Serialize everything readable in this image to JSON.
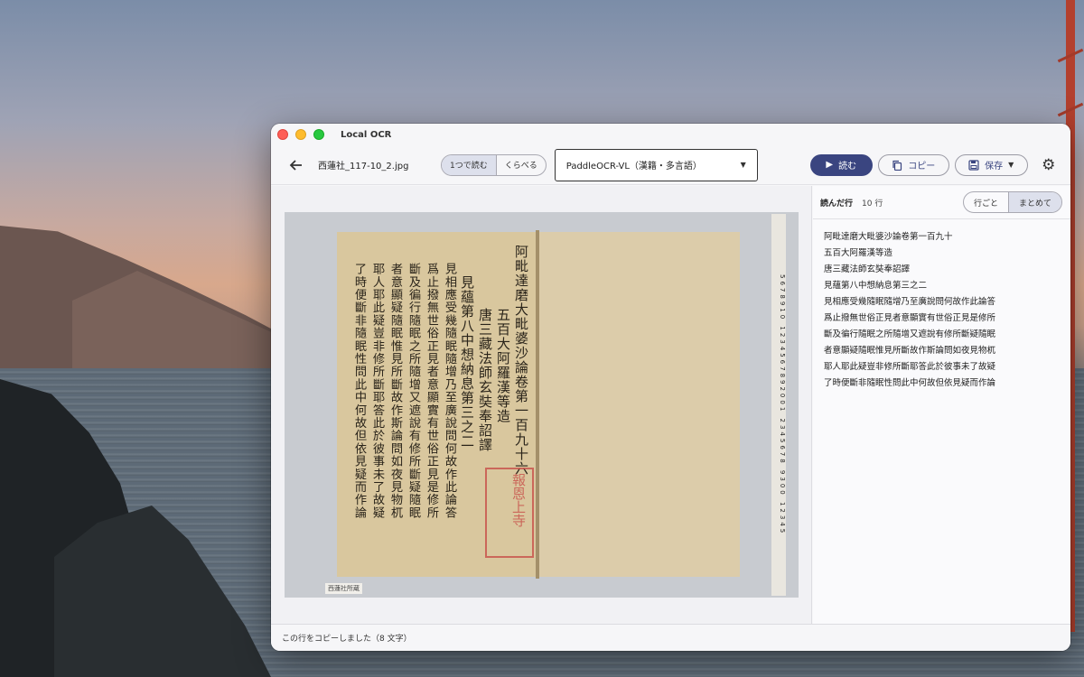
{
  "window": {
    "title": "Local OCR",
    "filename": "西蓮社_117-10_2.jpg"
  },
  "toolbar": {
    "mode_single": "1つで読む",
    "mode_compare": "くらべる",
    "model": "PaddleOCR-VL（漢籍・多言語）",
    "read_label": "読む",
    "copy_label": "コピー",
    "save_label": "保存"
  },
  "image": {
    "columns": [
      "阿毗達磨大毗婆沙論卷第一百九十六",
      "五百大阿羅漢等造",
      "唐三藏法師玄奘奉詔譯",
      "見蘊第八中想納息第三之二",
      "見相應受幾隨眠隨增乃至廣說問何故作此論答",
      "爲止撥無世俗正見者意顯實有世俗正見是修所",
      "斷及徧行隨眠之所隨增又遮說有修所斷疑隨眠",
      "者意顯疑隨眠惟見所斷故作斯論問如夜見物杌",
      "耶人耶此疑豈非修所斷耶答此於彼事未了故疑",
      "了時便斷非隨眠性問此中何故但依見疑而作論"
    ],
    "seal_text": "報恩上寺",
    "archive_label": "西蓮社所蔵",
    "ruler_marks": "5678910 1234567892001 2345678 9300 12345"
  },
  "results": {
    "title": "読んだ行",
    "count": "10 行",
    "view_per_line": "行ごと",
    "view_combined": "まとめて",
    "lines": [
      "阿毗達磨大毗婆沙論卷第一百九十",
      "五百大阿羅漢等造",
      "唐三藏法師玄奘奉詔譯",
      "見蘊第八中想納息第三之二",
      "見相應受幾隨眠隨增乃至廣說問何故作此論答",
      "爲止撥無世俗正見者意顯實有世俗正見是修所",
      "斷及徧行隨眠之所隨增又遮說有修所斷疑隨眠",
      "者意顯疑隨眠惟見所斷故作斯論問如夜見物杌",
      "耶人耶此疑豈非修所斷耶答此於彼事未了故疑",
      "了時便斷非隨眠性問此中何故但依見疑而作論"
    ]
  },
  "status": {
    "message": "この行をコピーしました（8 文字）"
  },
  "icons": {
    "back": "arrow-left-icon",
    "play": "play-icon",
    "copy": "copy-icon",
    "save": "floppy-disk-icon",
    "settings": "gear-icon"
  },
  "colors": {
    "accent": "#3a4580",
    "selected_segment": "#dde0ec"
  }
}
